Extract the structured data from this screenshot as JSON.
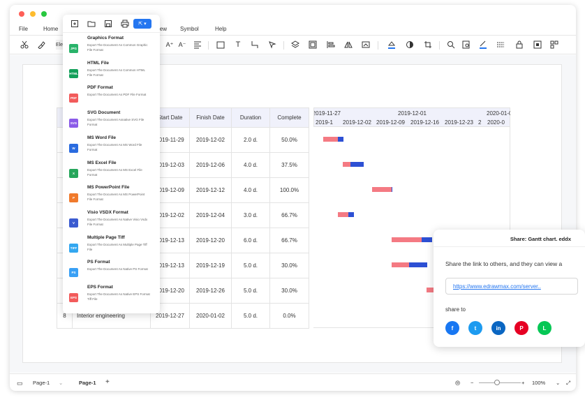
{
  "menu": [
    "File",
    "Home",
    "View",
    "Symbol",
    "Help"
  ],
  "toolbar": {
    "font_partial": "Ele"
  },
  "export_menu": {
    "items": [
      {
        "badge": "JPG",
        "color": "#29b36a",
        "title": "Graphics Format",
        "desc": "Export The Document As Common Graphic File Format"
      },
      {
        "badge": "HTML",
        "color": "#13a05a",
        "title": "HTML File",
        "desc": "Export The Document As Common HTML File Format"
      },
      {
        "badge": "PDF",
        "color": "#f25b5b",
        "title": "PDF Format",
        "desc": "Export The Document As PDF File Format"
      },
      {
        "badge": "SVG",
        "color": "#8b5be8",
        "title": "SVG Document",
        "desc": "Export The Document Asnative SVG File Format"
      },
      {
        "badge": "W",
        "color": "#2a6bdf",
        "title": "MS Word File",
        "desc": "Export The Document As MS Word File Format"
      },
      {
        "badge": "X",
        "color": "#26a65b",
        "title": "MS Excel File",
        "desc": "Export The Document As MS Excel File Format"
      },
      {
        "badge": "P",
        "color": "#f07a2c",
        "title": "MS PowerPoint File",
        "desc": "Export The Document As MS PowerPoint File Format"
      },
      {
        "badge": "V",
        "color": "#3b5bd0",
        "title": "Visio VSDX Format",
        "desc": "Export The Document As Native Visio Vsdx File Format"
      },
      {
        "badge": "TIFF",
        "color": "#33a7f0",
        "title": "Multiple Page Tiff",
        "desc": "Export The Document As Multiple Page Tiff File"
      },
      {
        "badge": "PS",
        "color": "#39a0f5",
        "title": "PS Format",
        "desc": "Export The Document As Native PS Format"
      },
      {
        "badge": "EPS",
        "color": "#f25b5b",
        "title": "EPS Format",
        "desc": "Export The Document As Native EPS Format Tiff File"
      }
    ]
  },
  "gantt": {
    "headers": [
      "Start Date",
      "Finish Date",
      "Duration",
      "Complete"
    ],
    "timeline_top": [
      "2019-11-27",
      "2019-12-01",
      "2020-01-0"
    ],
    "timeline_bottom": [
      "2019-1",
      "2019-12-02",
      "2019-12-09",
      "2019-12-16",
      "2019-12-23",
      "2",
      "2020-0"
    ],
    "rows": [
      {
        "num": "",
        "task": "",
        "start": "2019-11-29",
        "finish": "2019-12-02",
        "duration": "2.0 d.",
        "complete": "50.0%"
      },
      {
        "num": "",
        "task": "",
        "start": "2019-12-03",
        "finish": "2019-12-06",
        "duration": "4.0 d.",
        "complete": "37.5%"
      },
      {
        "num": "",
        "task": "",
        "start": "2019-12-09",
        "finish": "2019-12-12",
        "duration": "4.0 d.",
        "complete": "100.0%"
      },
      {
        "num": "",
        "task": "",
        "start": "2019-12-02",
        "finish": "2019-12-04",
        "duration": "3.0 d.",
        "complete": "66.7%"
      },
      {
        "num": "",
        "task": "",
        "start": "2019-12-13",
        "finish": "2019-12-20",
        "duration": "6.0 d.",
        "complete": "66.7%"
      },
      {
        "num": "",
        "task": "",
        "start": "2019-12-13",
        "finish": "2019-12-19",
        "duration": "5.0 d.",
        "complete": "30.0%"
      },
      {
        "num": "",
        "task": "",
        "start": "2019-12-20",
        "finish": "2019-12-26",
        "duration": "5.0 d.",
        "complete": "30.0%"
      },
      {
        "num": "8",
        "task": "Interior engineering",
        "start": "2019-12-27",
        "finish": "2020-01-02",
        "duration": "5.0 d.",
        "complete": "0.0%"
      }
    ]
  },
  "share": {
    "title": "Share: Gantt chart. eddx",
    "message": "Share the link to others, and they can view a",
    "link": "https://www.edrawmax.com/server..",
    "share_to": "share to",
    "networks": [
      {
        "name": "facebook-icon",
        "glyph": "f",
        "color": "#1877f2"
      },
      {
        "name": "twitter-icon",
        "glyph": "t",
        "color": "#1d9bf0"
      },
      {
        "name": "linkedin-icon",
        "glyph": "in",
        "color": "#0a66c2"
      },
      {
        "name": "pinterest-icon",
        "glyph": "P",
        "color": "#e60023"
      },
      {
        "name": "line-icon",
        "glyph": "L",
        "color": "#06c755"
      }
    ]
  },
  "statusbar": {
    "page_select": "Page-1",
    "page_tab": "Page-1",
    "zoom": "100%"
  }
}
